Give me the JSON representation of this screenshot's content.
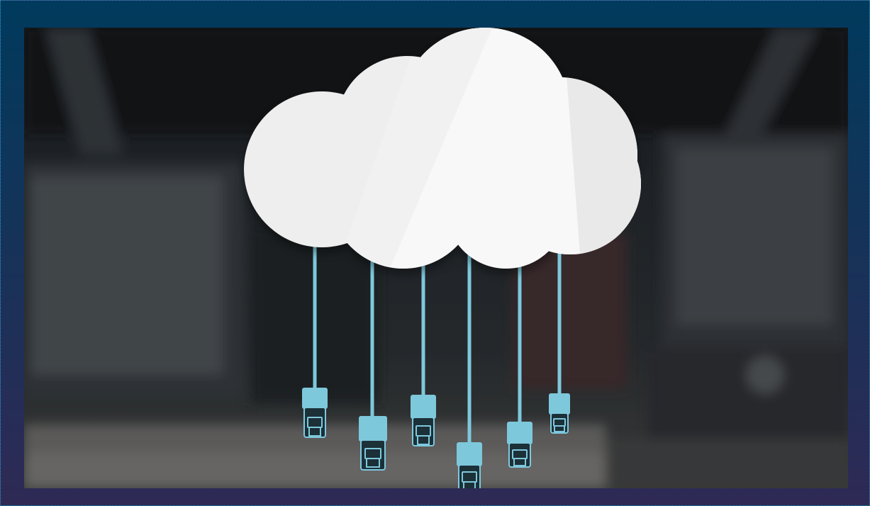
{
  "image": {
    "subject": "cloud-with-network-cables",
    "colors": {
      "frame_top": "#003a5c",
      "frame_bottom": "#2e2a55",
      "frame_border": "#3aa0d8",
      "backdrop": "#2a2e30",
      "cloud": "#f4f4f4",
      "cable": "#7ec8dc",
      "connector_dark": "#1c3038"
    },
    "cables": [
      {
        "id": "cable-1"
      },
      {
        "id": "cable-2"
      },
      {
        "id": "cable-3"
      },
      {
        "id": "cable-4"
      },
      {
        "id": "cable-5"
      },
      {
        "id": "cable-6"
      }
    ]
  }
}
